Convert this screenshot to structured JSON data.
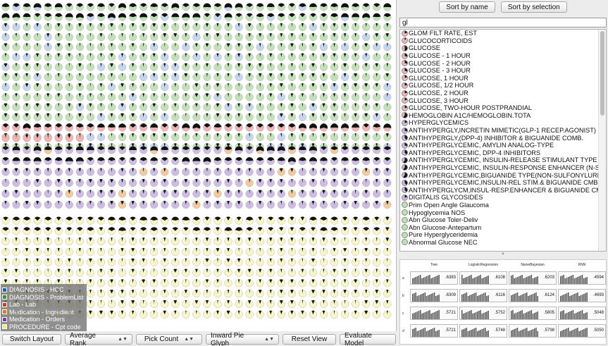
{
  "legend": {
    "items": [
      {
        "label": "DIAGNOSIS - HCC",
        "color": "#1f5fbf"
      },
      {
        "label": "DIAGNOSIS - ProblemList",
        "color": "#2e9a2e"
      },
      {
        "label": "Lab - Lab",
        "color": "#d04020"
      },
      {
        "label": "Medication - Ingredient",
        "color": "#e07820"
      },
      {
        "label": "Medication - Orders",
        "color": "#7a3da8"
      },
      {
        "label": "PROCEDURE - Cpt code",
        "color": "#f2ec7a"
      }
    ]
  },
  "toolbar": {
    "switch_layout": "Switch Layout",
    "average_rank": "Average Rank",
    "pick_count": "Pick Count",
    "inward_pie_glyph": "Inward Pie Glyph",
    "reset_view": "Reset View",
    "evaluate_model": "Evaluate Model"
  },
  "sort": {
    "by_name": "Sort by name",
    "by_selection": "Sort by selection"
  },
  "search": {
    "value": "gl"
  },
  "concepts": [
    {
      "label": "GLOM FILT RATE, EST",
      "color": "#f2b6b6",
      "fill": 0.2
    },
    {
      "label": "GLUCOCORTICOIDS",
      "color": "#f2b6b6",
      "fill": 0.1
    },
    {
      "label": "GLUCOSE",
      "color": "#f2b6b6",
      "fill": 0.5
    },
    {
      "label": "GLUCOSE - 1 HOUR",
      "color": "#f2b6b6",
      "fill": 0.3
    },
    {
      "label": "GLUCOSE - 2 HOUR",
      "color": "#f2b6b6",
      "fill": 0.3
    },
    {
      "label": "GLUCOSE - 3 HOUR",
      "color": "#f2b6b6",
      "fill": 0.3
    },
    {
      "label": "GLUCOSE, 1 HOUR",
      "color": "#f2b6b6",
      "fill": 0.2
    },
    {
      "label": "GLUCOSE, 1/2 HOUR",
      "color": "#f2b6b6",
      "fill": 0.2
    },
    {
      "label": "GLUCOSE, 2 HOUR",
      "color": "#f2b6b6",
      "fill": 0.2
    },
    {
      "label": "GLUCOSE, 3 HOUR",
      "color": "#f2b6b6",
      "fill": 0.2
    },
    {
      "label": "GLUCOSE, TWO-HOUR POSTPRANDIAL",
      "color": "#f2b6b6",
      "fill": 0.2
    },
    {
      "label": "HEMOGLOBIN A1C/HEMOGLOBIN.TOTA",
      "color": "#f2b6b6",
      "fill": 0.6
    },
    {
      "label": "HYPERGLYCEMICS",
      "color": "#cdb6e6",
      "fill": 0.2
    },
    {
      "label": "ANTIHYPERGLY,INCRETIN MIMETIC(GLP-1 RECEP.AGONIST)",
      "color": "#cdb6e6",
      "fill": 0.3
    },
    {
      "label": "ANTIHYPERGLY,(DPP-4) INHIBITOR & BIGUANIDE COMB.",
      "color": "#cdb6e6",
      "fill": 0.4
    },
    {
      "label": "ANTIHYPERGLYCEMIC, AMYLIN ANALOG-TYPE",
      "color": "#cdb6e6",
      "fill": 0.3
    },
    {
      "label": "ANTIHYPERGLYCEMIC, DPP-4 INHIBITORS",
      "color": "#cdb6e6",
      "fill": 0.4
    },
    {
      "label": "ANTIHYPERGLYCEMIC, INSULIN-RELEASE STIMULANT TYPE",
      "color": "#cdb6e6",
      "fill": 0.6
    },
    {
      "label": "ANTIHYPERGLYCEMIC, INSULIN-RESPONSE ENHANCER (N-S)",
      "color": "#cdb6e6",
      "fill": 0.6
    },
    {
      "label": "ANTIHYPERGLYCEMIC,BIGUANIDE TYPE(NON-SULFONYLUREA)",
      "color": "#cdb6e6",
      "fill": 0.6
    },
    {
      "label": "ANTIHYPERGLYCEMIC,INSULIN-REL STIM.& BIGUANIDE CMB",
      "color": "#cdb6e6",
      "fill": 0.4
    },
    {
      "label": "ANTIHYPERGLYCM,INSUL-RESP.ENHANCER & BIGUANIDE CMB",
      "color": "#cdb6e6",
      "fill": 0.4
    },
    {
      "label": "DIGITALIS GLYCOSIDES",
      "color": "#cdb6e6",
      "fill": 0.2
    },
    {
      "label": "Prim Open Angle Glaucoma",
      "color": "#bfe0b6",
      "fill": 0.0
    },
    {
      "label": "Hypoglycemia NOS",
      "color": "#bfe0b6",
      "fill": 0.0
    },
    {
      "label": "Abn Glucose Toler-Deliv",
      "color": "#bfe0b6",
      "fill": 0.0
    },
    {
      "label": "Abn Glucose-Antepartum",
      "color": "#bfe0b6",
      "fill": 0.0
    },
    {
      "label": "Pure Hyperglyceridemia",
      "color": "#bfe0b6",
      "fill": 0.0
    },
    {
      "label": "Abnormal Glucose NEC",
      "color": "#bfe0b6",
      "fill": 0.0
    }
  ],
  "models": {
    "headers": [
      "Tree",
      "LogisticRegression",
      "NaiveBayesian",
      "KNN"
    ],
    "rows": [
      {
        "label": "a",
        "scores": [
          ".6383",
          ".6108",
          ".6203",
          ".4594"
        ]
      },
      {
        "label": "b",
        "scores": [
          ".6309",
          ".6116",
          ".6124",
          ".4693"
        ]
      },
      {
        "label": "c",
        "scores": [
          ".5721",
          ".5752",
          ".5805",
          ".5048"
        ]
      },
      {
        "label": "d",
        "scores": [
          ".5721",
          ".5748",
          ".5798",
          ".5050"
        ]
      }
    ]
  },
  "glyph_colors": {
    "green": "#c3e2b8",
    "blue": "#c6d6ee",
    "red": "#f1b3b3",
    "purple": "#cdbde4",
    "orange": "#f4c99c",
    "yellow": "#f8f6c6",
    "wedge": "#111111"
  }
}
